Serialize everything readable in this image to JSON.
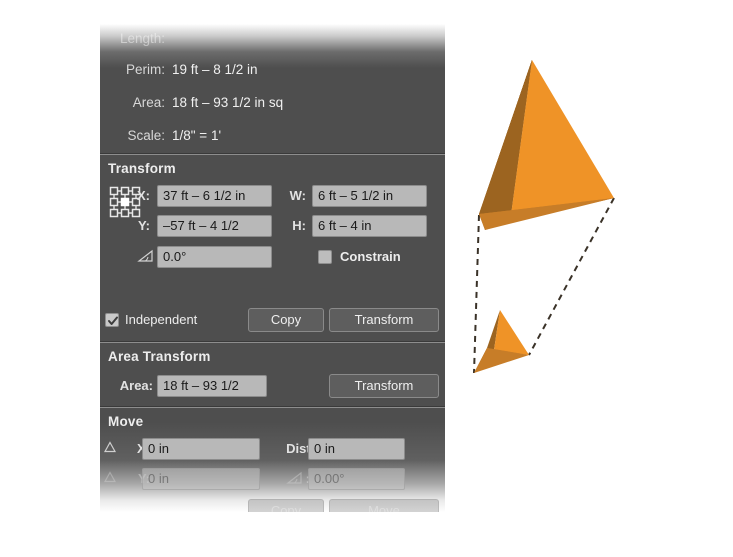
{
  "panel": {
    "readouts": [
      {
        "label": "Length:",
        "value": "",
        "dim": true
      },
      {
        "label": "Perim:",
        "value": "19 ft – 8 1/2 in"
      },
      {
        "label": "Area:",
        "value": "18 ft – 93 1/2 in sq"
      },
      {
        "label": "Scale:",
        "value": "1/8\" = 1'"
      }
    ],
    "transform": {
      "heading": "Transform",
      "anchor_icon": "anchor-point-grid-icon",
      "x_label": "X:",
      "x_value": "37 ft – 6 1/2 in",
      "y_label": "Y:",
      "y_value": "–57 ft – 4 1/2",
      "w_label": "W:",
      "w_value": "6 ft – 5 1/2 in",
      "h_label": "H:",
      "h_value": "6 ft – 4 in",
      "angle_label": "⊿:",
      "angle_value": "0.0°",
      "constrain_label": "Constrain",
      "constrain_checked": false,
      "independent_label": "Independent",
      "independent_checked": true,
      "copy_label": "Copy",
      "transform_label": "Transform"
    },
    "area_transform": {
      "heading": "Area Transform",
      "area_label": "Area:",
      "area_value": "18 ft – 93 1/2",
      "transform_label": "Transform"
    },
    "move": {
      "heading": "Move",
      "dx_label": "X:",
      "dx_value": "0 in",
      "dy_label": "Y:",
      "dy_value": "0 in",
      "dist_label": "Dist:",
      "dist_value": "0 in",
      "angle_label": "⊿:",
      "angle_value": "0.00°",
      "copy_label": "Copy",
      "move_label": "Move"
    }
  },
  "canvas": {
    "shapes": {
      "large_tetrahedron": "large-tetrahedron",
      "small_tetrahedron": "small-tetrahedron",
      "guide_lines": "transform-guide-lines"
    },
    "colors": {
      "face_light": "#ef9327",
      "face_mid": "#c77d28",
      "face_dark": "#9c6420",
      "guide": "#3a3228",
      "background": "#ffffff"
    }
  }
}
